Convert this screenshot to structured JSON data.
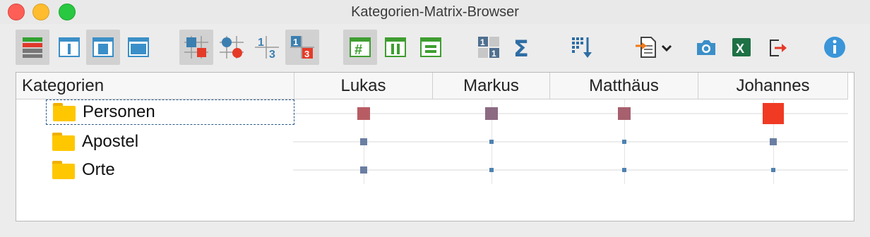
{
  "window": {
    "title": "Kategorien-Matrix-Browser"
  },
  "toolbar": {
    "buttons": [
      {
        "icon": "color-rows-icon",
        "active": true
      },
      {
        "icon": "column-view-icon",
        "active": false
      },
      {
        "icon": "center-view-icon",
        "active": true
      },
      {
        "icon": "full-view-icon",
        "active": false
      },
      {
        "icon": "squares-display-icon",
        "active": true
      },
      {
        "icon": "circles-display-icon",
        "active": false
      },
      {
        "icon": "numbers-display-icon",
        "active": false
      },
      {
        "icon": "highlighted-numbers-icon",
        "active": true
      },
      {
        "icon": "grid-cell-icon",
        "active": true
      },
      {
        "icon": "column-cell-icon",
        "active": false
      },
      {
        "icon": "row-cell-icon",
        "active": false
      },
      {
        "icon": "tile-numbers-icon",
        "active": false
      },
      {
        "icon": "sum-icon",
        "active": false
      },
      {
        "icon": "sort-descending-icon",
        "active": false
      },
      {
        "icon": "export-dropdown-icon",
        "active": false
      },
      {
        "icon": "camera-icon",
        "active": false
      },
      {
        "icon": "excel-icon",
        "active": false
      },
      {
        "icon": "exit-icon",
        "active": false
      },
      {
        "icon": "info-icon",
        "active": false
      }
    ]
  },
  "matrix": {
    "header_first": "Kategorien",
    "columns": [
      "Lukas",
      "Markus",
      "Matthäus",
      "Johannes"
    ],
    "rows": [
      {
        "label": "Personen",
        "selected": true
      },
      {
        "label": "Apostel",
        "selected": false
      },
      {
        "label": "Orte",
        "selected": false
      }
    ],
    "cells": [
      [
        {
          "level": 3,
          "color": "#b85c64"
        },
        {
          "level": 2,
          "color": "#8c6a82"
        },
        {
          "level": 2,
          "color": "#a6606e"
        },
        {
          "level": 4,
          "color": "#f03a24"
        }
      ],
      [
        {
          "level": 1,
          "color": "#6a7ea2"
        },
        {
          "level": 0,
          "color": "#4f82b0"
        },
        {
          "level": 0,
          "color": "#4f82b0"
        },
        {
          "level": 1,
          "color": "#6a7ea2"
        }
      ],
      [
        {
          "level": 1,
          "color": "#6a7ea2"
        },
        {
          "level": 0,
          "color": "#4f82b0"
        },
        {
          "level": 0,
          "color": "#4f82b0"
        },
        {
          "level": 0,
          "color": "#4f82b0"
        }
      ]
    ]
  }
}
